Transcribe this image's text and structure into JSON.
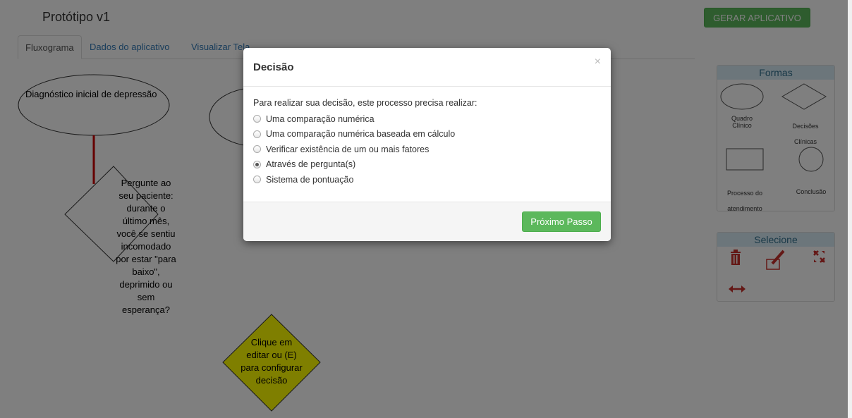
{
  "header": {
    "app_title": "Protótipo v1",
    "generate_button": "GERAR APLICATIVO"
  },
  "tabs": [
    {
      "label": "Fluxograma",
      "active": true
    },
    {
      "label": "Dados do aplicativo",
      "active": false
    },
    {
      "label": "Visualizar Tela",
      "active": false
    }
  ],
  "flowchart": {
    "start_node": "Diagnóstico inicial de depressão",
    "question_node": [
      "Pergunte ao",
      "seu paciente:",
      "durante o",
      "último mês,",
      "você se sentiu",
      "incomodado",
      "por estar \"para",
      "baixo\",",
      "deprimido ou",
      "sem",
      "esperança?"
    ],
    "decision_node": [
      "Clique em",
      "editar ou (E)",
      "para configurar",
      "decisão"
    ]
  },
  "shapes_panel": {
    "title": "Formas",
    "items": [
      {
        "label": "Quadro Clínico",
        "icon": "ellipse-shape-icon"
      },
      {
        "label": "Decisões Clínicas",
        "icon": "diamond-shape-icon"
      },
      {
        "label": "Processo do atendimento",
        "icon": "rectangle-shape-icon"
      },
      {
        "label": "Conclusão",
        "icon": "circle-shape-icon"
      }
    ]
  },
  "select_panel": {
    "title": "Selecione",
    "tools": [
      "trash-icon",
      "edit-icon",
      "expand-icon",
      "resize-horizontal-icon"
    ]
  },
  "modal": {
    "title": "Decisão",
    "close_label": "×",
    "intro": "Para realizar sua decisão, este processo precisa realizar:",
    "options": [
      {
        "label": "Uma comparação numérica",
        "checked": false
      },
      {
        "label": "Uma comparação numérica baseada em cálculo",
        "checked": false
      },
      {
        "label": "Verificar existência de um ou mais fatores",
        "checked": false
      },
      {
        "label": "Através de pergunta(s)",
        "checked": true
      },
      {
        "label": "Sistema de pontuação",
        "checked": false
      }
    ],
    "next_button": "Próximo Passo"
  },
  "colors": {
    "accent_green": "#5cb85c",
    "link_blue": "#337ab7",
    "panel_header": "#d9edf7",
    "tool_red": "#c9302c",
    "flow_red": "#cc0000",
    "decision_yellow": "#ffff00"
  }
}
